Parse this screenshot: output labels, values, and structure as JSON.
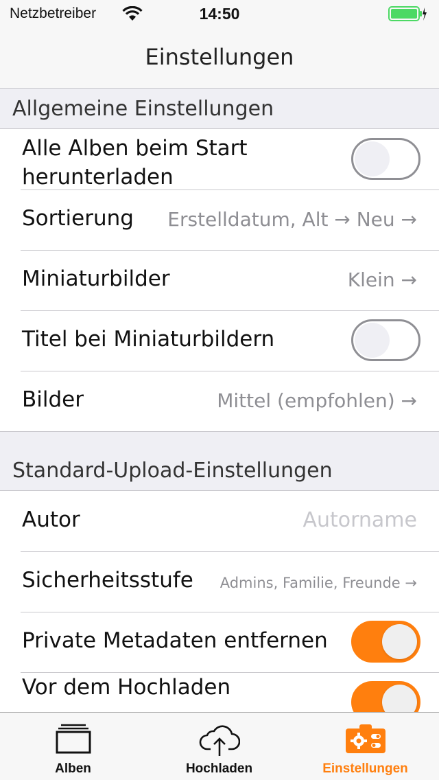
{
  "status": {
    "carrier": "Netzbetreiber",
    "time": "14:50"
  },
  "nav": {
    "title": "Einstellungen"
  },
  "general": {
    "header": "Allgemeine Einstellungen",
    "download_all_line1": "Alle Alben beim Start",
    "download_all_line2": "herunterladen",
    "download_all_on": false,
    "sort_label": "Sortierung",
    "sort_value": "Erstelldatum, Alt → Neu →",
    "thumbs_label": "Miniaturbilder",
    "thumbs_value": "Klein →",
    "thumb_titles_label": "Titel bei Miniaturbildern",
    "thumb_titles_on": false,
    "images_label": "Bilder",
    "images_value": "Mittel (empfohlen) →"
  },
  "upload": {
    "header": "Standard-Upload-Einstellungen",
    "author_label": "Autor",
    "author_placeholder": "Autorname",
    "privacy_label": "Sicherheitsstufe",
    "privacy_value": "Admins, Familie, Freunde →",
    "strip_meta_label": "Private Metadaten entfernen",
    "strip_meta_on": true,
    "resize_line1": "Vor dem Hochladen",
    "resize_on": true
  },
  "tabs": [
    {
      "label": "Alben",
      "icon": "albums-icon"
    },
    {
      "label": "Hochladen",
      "icon": "cloud-upload-icon"
    },
    {
      "label": "Einstellungen",
      "icon": "settings-icon"
    }
  ],
  "colors": {
    "accent": "#ff7f0e",
    "secondary_text": "#8e8e93"
  }
}
